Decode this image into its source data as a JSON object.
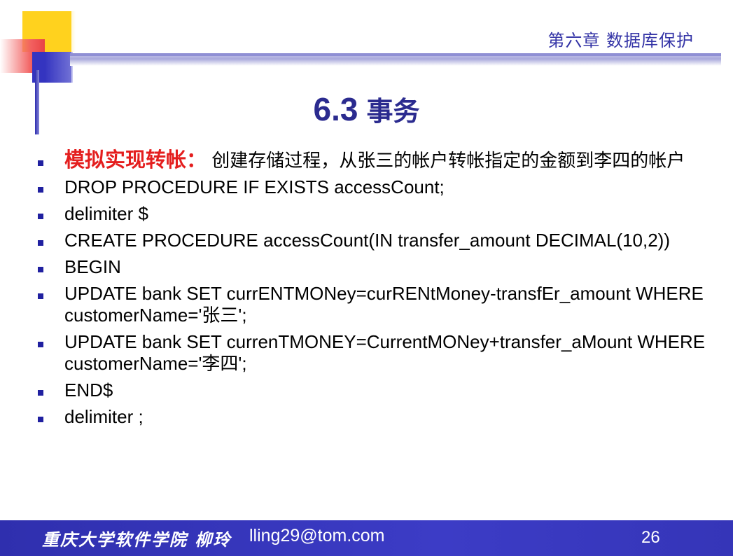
{
  "header": {
    "chapter": "第六章 数据库保护"
  },
  "title": {
    "number": "6.3",
    "text": "事务"
  },
  "bullets": {
    "first": {
      "highlight": "模拟实现转帐：",
      "text": "创建存储过程，从张三的帐户转帐指定的金额到李四的帐户"
    },
    "items": [
      "DROP PROCEDURE IF EXISTS accessCount;",
      "delimiter $",
      "CREATE PROCEDURE accessCount(IN transfer_amount DECIMAL(10,2))",
      "BEGIN",
      "UPDATE bank SET currENTMONey=curRENtMoney-transfEr_amount WHERE customerName='张三';",
      "UPDATE bank SET currenTMONEY=CurrentMONey+transfer_aMount WHERE customerName='李四';",
      "END$",
      "delimiter ;"
    ]
  },
  "footer": {
    "institution": "重庆大学软件学院 柳玲",
    "email": "lling29@tom.com",
    "page_number": "26"
  },
  "colors": {
    "title": "#2b2b8f",
    "highlight": "#e41e1e",
    "footer_bg": "#3535b8",
    "bullet_marker": "#2020a0"
  }
}
